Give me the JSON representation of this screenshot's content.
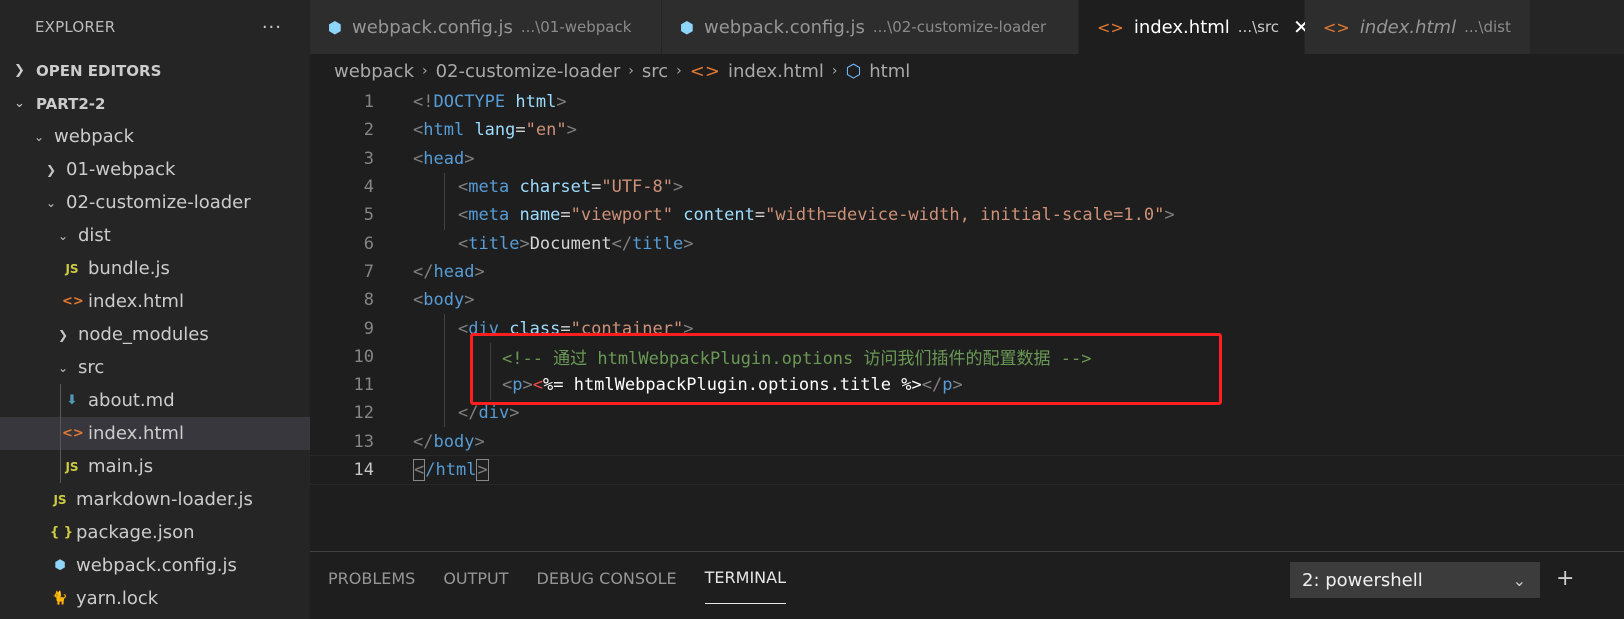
{
  "sidebar": {
    "title": "EXPLORER",
    "more": "···",
    "open_editors": "OPEN EDITORS",
    "workspace": "PART2-2",
    "tree": [
      {
        "label": "webpack",
        "icon": "chevron-down-icon"
      },
      {
        "label": "01-webpack",
        "icon": "chevron-right-icon"
      },
      {
        "label": "02-customize-loader",
        "icon": "chevron-down-icon"
      },
      {
        "label": "dist",
        "icon": "chevron-down-icon"
      },
      {
        "label": "bundle.js",
        "icon": "js-file-icon",
        "glyph": "JS"
      },
      {
        "label": "index.html",
        "icon": "html-file-icon",
        "glyph": "<>"
      },
      {
        "label": "node_modules",
        "icon": "chevron-right-icon"
      },
      {
        "label": "src",
        "icon": "chevron-down-icon"
      },
      {
        "label": "about.md",
        "icon": "markdown-file-icon",
        "glyph": "⬇"
      },
      {
        "label": "index.html",
        "icon": "html-file-icon",
        "glyph": "<>"
      },
      {
        "label": "main.js",
        "icon": "js-file-icon",
        "glyph": "JS"
      },
      {
        "label": "markdown-loader.js",
        "icon": "js-file-icon",
        "glyph": "JS"
      },
      {
        "label": "package.json",
        "icon": "json-file-icon",
        "glyph": "{ }"
      },
      {
        "label": "webpack.config.js",
        "icon": "webpack-file-icon",
        "glyph": "⬢"
      },
      {
        "label": "yarn.lock",
        "icon": "yarn-file-icon",
        "glyph": "🐈"
      }
    ]
  },
  "tabs": [
    {
      "name": "webpack.config.js",
      "desc": "...\\01-webpack",
      "glyph": "⬢"
    },
    {
      "name": "webpack.config.js",
      "desc": "...\\02-customize-loader",
      "glyph": "⬢"
    },
    {
      "name": "index.html",
      "desc": "...\\src",
      "glyph": "<>",
      "close": "✕"
    },
    {
      "name": "index.html",
      "desc": "...\\dist",
      "glyph": "<>"
    }
  ],
  "breadcrumb": {
    "items": [
      "webpack",
      "02-customize-loader",
      "src",
      "index.html",
      "html"
    ],
    "sep": "›"
  },
  "editor": {
    "line_numbers": [
      "1",
      "2",
      "3",
      "4",
      "5",
      "6",
      "7",
      "8",
      "9",
      "10",
      "11",
      "12",
      "13",
      "14"
    ],
    "lines": {
      "l1": {
        "a": "<!",
        "b": "DOCTYPE",
        "c": " html",
        "d": ">"
      },
      "l2": {
        "a": "<",
        "b": "html",
        "c": " lang",
        "d": "=",
        "e": "\"en\"",
        "f": ">"
      },
      "l3": {
        "a": "<",
        "b": "head",
        "c": ">"
      },
      "l4": {
        "a": "<",
        "b": "meta",
        "c": " charset",
        "d": "=",
        "e": "\"UTF-8\"",
        "f": ">"
      },
      "l5": {
        "a": "<",
        "b": "meta",
        "c": " name",
        "d": "=",
        "e": "\"viewport\"",
        "f": " content",
        "g": "=",
        "h": "\"width=device-width, initial-scale=1.0\"",
        "i": ">"
      },
      "l6": {
        "a": "<",
        "b": "title",
        "c": ">",
        "d": "Document",
        "e": "</",
        "f": "title",
        "g": ">"
      },
      "l7": {
        "a": "</",
        "b": "head",
        "c": ">"
      },
      "l8": {
        "a": "<",
        "b": "body",
        "c": ">"
      },
      "l9": {
        "a": "<",
        "b": "div",
        "c": " class",
        "d": "=",
        "e": "\"container\"",
        "f": ">"
      },
      "l10": {
        "a": "<!-- 通过 htmlWebpackPlugin.options 访问我们插件的配置数据 -->"
      },
      "l11": {
        "a": "<",
        "b": "p",
        "c": ">",
        "d": "<",
        "e": "%= htmlWebpackPlugin.options.title %>",
        "f": "</",
        "g": "p",
        "h": ">"
      },
      "l12": {
        "a": "</",
        "b": "div",
        "c": ">"
      },
      "l13": {
        "a": "</",
        "b": "body",
        "c": ">"
      },
      "l14": {
        "a": "<",
        "b": "/html",
        "c": ">"
      }
    }
  },
  "panel": {
    "tabs": [
      "PROBLEMS",
      "OUTPUT",
      "DEBUG CONSOLE",
      "TERMINAL"
    ],
    "terminal_select": "2: powershell",
    "dropdown": "⌄",
    "plus": "+"
  }
}
